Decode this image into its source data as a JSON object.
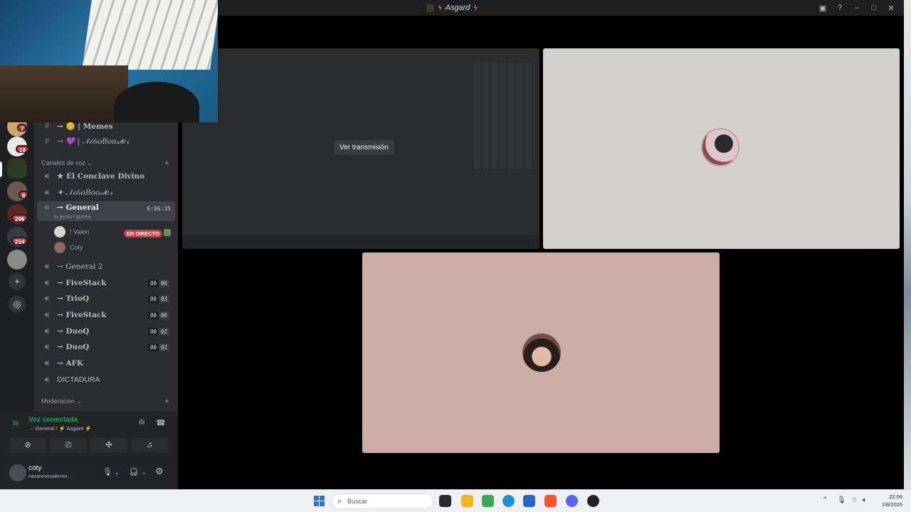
{
  "window": {
    "title": "Asgard",
    "title_icon": "guild-icon",
    "controls": [
      "inbox-icon",
      "help-icon",
      "minimize-icon",
      "maximize-icon",
      "close-icon"
    ]
  },
  "rail": {
    "servers": [
      {
        "badge": "7"
      },
      {
        "badge": "19"
      },
      {
        "badge": ""
      },
      {
        "badge": "8"
      },
      {
        "badge": "298"
      },
      {
        "badge": "214"
      },
      {
        "badge": ""
      }
    ],
    "actions": [
      "add-server-icon",
      "explore-icon"
    ]
  },
  "channels": {
    "text": [
      {
        "name": "→ 🥴 | Memes"
      },
      {
        "name": "→ 💜 | 𝒩𝒾𝓉𝓇𝑜𝐵𝑜𝑜𝓈𝓉𝑒𝓇"
      }
    ],
    "voice_category": "Canales de voz",
    "voice": [
      {
        "name": "★ El Conclave Divino"
      },
      {
        "name": "✦ 𝒩𝒾𝓉𝓇𝑜𝐵𝑜𝑜𝓈𝓉𝑒𝓇"
      },
      {
        "name": "→ General",
        "time": "6:06:35",
        "status": "tu jermu t gorrea"
      },
      {
        "name": "→ General 2"
      },
      {
        "name": "→ FiveStack",
        "count": [
          "00",
          "06"
        ]
      },
      {
        "name": "→ TrioQ",
        "count": [
          "00",
          "03"
        ]
      },
      {
        "name": "→ FiveStack",
        "count": [
          "00",
          "06"
        ]
      },
      {
        "name": "→ DuoQ",
        "count": [
          "00",
          "02"
        ]
      },
      {
        "name": "→ DuoQ",
        "count": [
          "00",
          "02"
        ]
      },
      {
        "name": "→ AFK"
      },
      {
        "name": "DICTADURA"
      }
    ],
    "members": [
      {
        "name": "! Valen",
        "live": "EN DIRECTO"
      },
      {
        "name": "Coty"
      }
    ],
    "mod_category": "Moderacion"
  },
  "voice_panel": {
    "status": "Voz conectada",
    "location": "→ General / ⚡ Asgard ⚡"
  },
  "user_panel": {
    "username": "coty",
    "status": "nazarenosalermo..."
  },
  "stage": {
    "watch_label": "Ver transmisión"
  },
  "taskbar": {
    "search_placeholder": "Buscar",
    "time": "22:06",
    "date": "1/8/2026"
  },
  "colors": {
    "accent_green": "#23a55a",
    "live_red": "#da373c",
    "sidebar": "#2b2d31",
    "tile_user1": "#d2d1cd",
    "tile_user2": "#ccaca6"
  }
}
